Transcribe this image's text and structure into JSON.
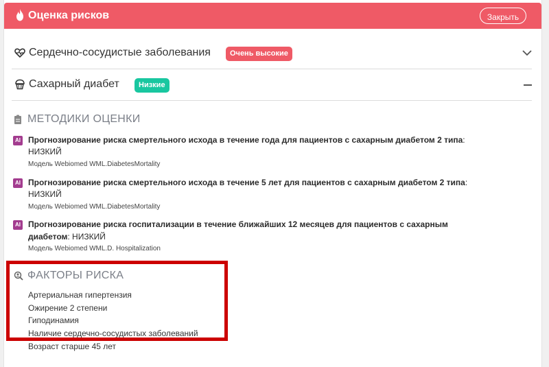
{
  "header": {
    "title": "Оценка рисков",
    "close_label": "Закрыть"
  },
  "conditions": [
    {
      "label": "Сердечно-сосудистые заболевания",
      "badge": "Очень высокие"
    },
    {
      "label": "Сахарный диабет",
      "badge": "Низкие"
    }
  ],
  "methods_section": {
    "title": "МЕТОДИКИ ОЦЕНКИ",
    "items": [
      {
        "ai": "AI",
        "title": "Прогнозирование риска смертельного исхода в течение года для пациентов с сахарным диабетом 2 типа",
        "suffix": ":",
        "result": "НИЗКИЙ",
        "model": "Модель Webiomed WML.DiabetesMortality"
      },
      {
        "ai": "AI",
        "title": "Прогнозирование риска смертельного исхода в течение 5 лет для пациентов с сахарным диабетом 2 типа",
        "suffix": ":",
        "result": "НИЗКИЙ",
        "model": "Модель Webiomed WML.DiabetesMortality"
      },
      {
        "ai": "AI",
        "title": "Прогнозирование риска госпитализации в течение ближайших 12 месяцев для пациентов с сахарным диабетом",
        "suffix": ": НИЗКИЙ",
        "result": "",
        "model": "Модель Webiomed WML.D. Hospitalization"
      }
    ]
  },
  "factors_section": {
    "title": "ФАКТОРЫ РИСКА",
    "items": [
      "Артериальная гипертензия",
      "Ожирение 2 степени",
      "Гиподинамия",
      "Наличие сердечно-сосудистых заболеваний",
      "Возраст старше 45 лет"
    ]
  },
  "colors": {
    "header": "#ef5a66",
    "badge_high": "#ef5a66",
    "badge_low": "#19c7a0",
    "ai_badge": "#a33c8f",
    "highlight": "#cc0000"
  }
}
